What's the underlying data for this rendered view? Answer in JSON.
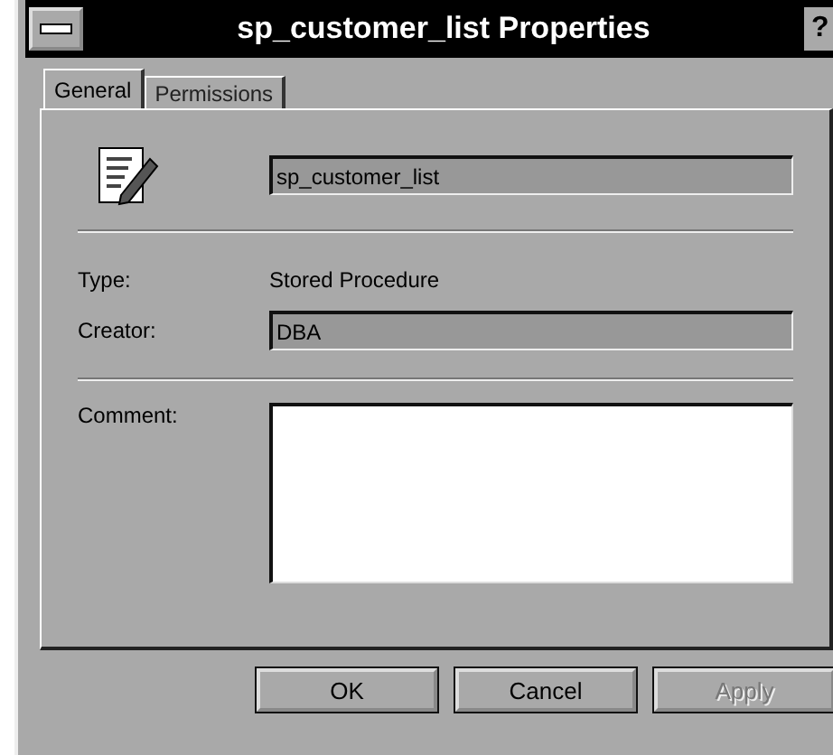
{
  "window": {
    "title": "sp_customer_list Properties",
    "help_button": "?"
  },
  "tabs": [
    {
      "label": "General",
      "selected": true
    },
    {
      "label": "Permissions",
      "selected": false
    }
  ],
  "name_field": {
    "value": "sp_customer_list"
  },
  "properties": [
    {
      "label": "Type:",
      "kind": "text",
      "value": "Stored Procedure"
    },
    {
      "label": "Creator:",
      "kind": "field",
      "value": "DBA"
    }
  ],
  "comment": {
    "label": "Comment:"
  },
  "buttons": [
    {
      "label": "OK",
      "disabled": false
    },
    {
      "label": "Cancel",
      "disabled": false
    },
    {
      "label": "Apply",
      "disabled": true
    }
  ]
}
